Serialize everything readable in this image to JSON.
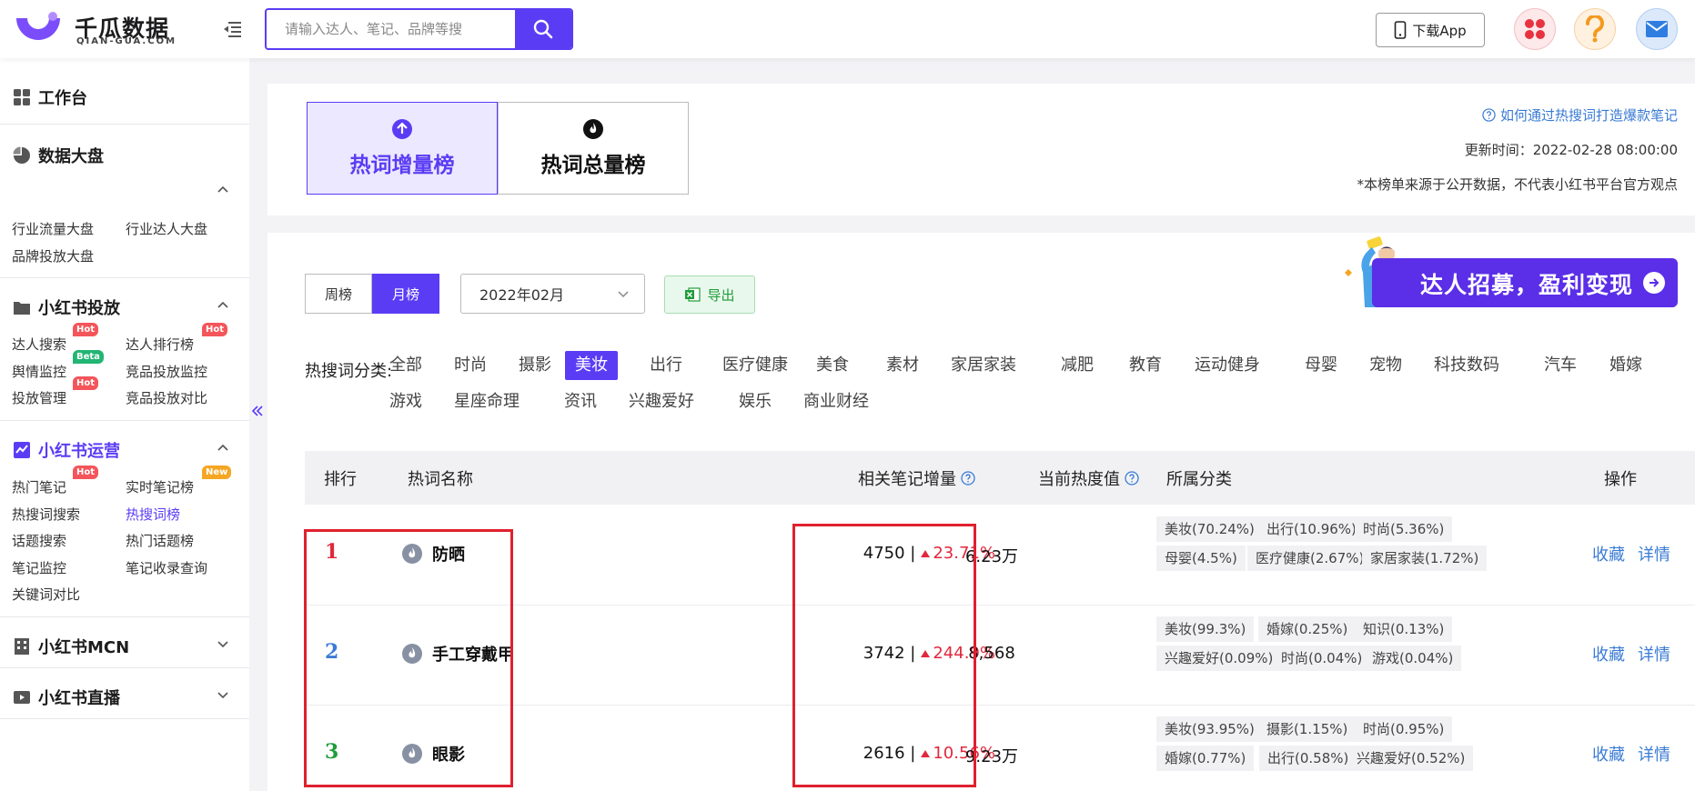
{
  "brand": {
    "name_cn": "千瓜数据",
    "name_en": "QIAN-GUA.COM"
  },
  "search": {
    "placeholder": "请输入达人、笔记、品牌等搜"
  },
  "header": {
    "download_label": "下载App"
  },
  "sidebar": {
    "workbench": "工作台",
    "sections": [
      {
        "title": "数据大盘",
        "links": [
          "行业流量大盘",
          "行业达人大盘",
          "品牌投放大盘"
        ]
      },
      {
        "title": "小红书投放",
        "links": [
          "达人搜索",
          "达人排行榜",
          "舆情监控",
          "竞品投放监控",
          "投放管理",
          "竞品投放对比"
        ]
      },
      {
        "title": "小红书运营",
        "links": [
          "热门笔记",
          "实时笔记榜",
          "热搜词搜索",
          "热搜词榜",
          "话题搜索",
          "热门话题榜",
          "笔记监控",
          "笔记收录查询",
          "关键词对比"
        ]
      },
      {
        "title": "小红书MCN"
      },
      {
        "title": "小红书直播"
      }
    ],
    "badges": {
      "hot": "Hot",
      "beta": "Beta",
      "new": "New"
    }
  },
  "ranking_tabs": [
    {
      "label": "热词增量榜",
      "active": true
    },
    {
      "label": "热词总量榜",
      "active": false
    }
  ],
  "info": {
    "help_link": "如何通过热搜词打造爆款笔记",
    "update_time": "更新时间：2022-02-28 08:00:00",
    "disclaimer": "*本榜单来源于公开数据，不代表小红书平台官方观点"
  },
  "filters": {
    "period": [
      "周榜",
      "月榜"
    ],
    "period_selected": "月榜",
    "month": "2022年02月",
    "export_label": "导出"
  },
  "promo": {
    "text": "达人招募，盈利变现"
  },
  "categories": {
    "label": "热搜词分类:",
    "items": [
      "全部",
      "时尚",
      "摄影",
      "美妆",
      "出行",
      "医疗健康",
      "美食",
      "素材",
      "家居家装",
      "减肥",
      "教育",
      "运动健身",
      "母婴",
      "宠物",
      "科技数码",
      "汽车",
      "婚嫁",
      "游戏",
      "星座命理",
      "资讯",
      "兴趣爱好",
      "娱乐",
      "商业财经"
    ],
    "selected": "美妆"
  },
  "table": {
    "headers": {
      "rank": "排行",
      "keyword": "热词名称",
      "growth": "相关笔记增量",
      "heat": "当前热度值",
      "category": "所属分类",
      "ops": "操作"
    },
    "rows": [
      {
        "rank": "1",
        "rank_color": "#e1283c",
        "keyword": "防晒",
        "growth": "4750 |",
        "pct": "23.71%",
        "heat": "6.23万",
        "tags": [
          "美妆(70.24%)",
          "出行(10.96%)",
          "时尚(5.36%)",
          "母婴(4.5%)",
          "医疗健康(2.67%)",
          "家居家装(1.72%)"
        ]
      },
      {
        "rank": "2",
        "rank_color": "#3a7bd5",
        "keyword": "手工穿戴甲",
        "growth": "3742 |",
        "pct": "244.9%",
        "heat": "8,568",
        "tags": [
          "美妆(99.3%)",
          "婚嫁(0.25%)",
          "知识(0.13%)",
          "兴趣爱好(0.09%)",
          "时尚(0.04%)",
          "游戏(0.04%)"
        ]
      },
      {
        "rank": "3",
        "rank_color": "#1f9d3a",
        "keyword": "眼影",
        "growth": "2616 |",
        "pct": "10.56%",
        "heat": "9.23万",
        "tags": [
          "美妆(93.95%)",
          "摄影(1.15%)",
          "时尚(0.95%)",
          "婚嫁(0.77%)",
          "出行(0.58%)",
          "兴趣爱好(0.52%)"
        ]
      }
    ],
    "op_collect": "收藏",
    "op_detail": "详情"
  },
  "colors": {
    "accent": "#5b3cf5",
    "up": "#e1283c",
    "link": "#3a7bd5",
    "highlight_box": "#e0202e"
  }
}
